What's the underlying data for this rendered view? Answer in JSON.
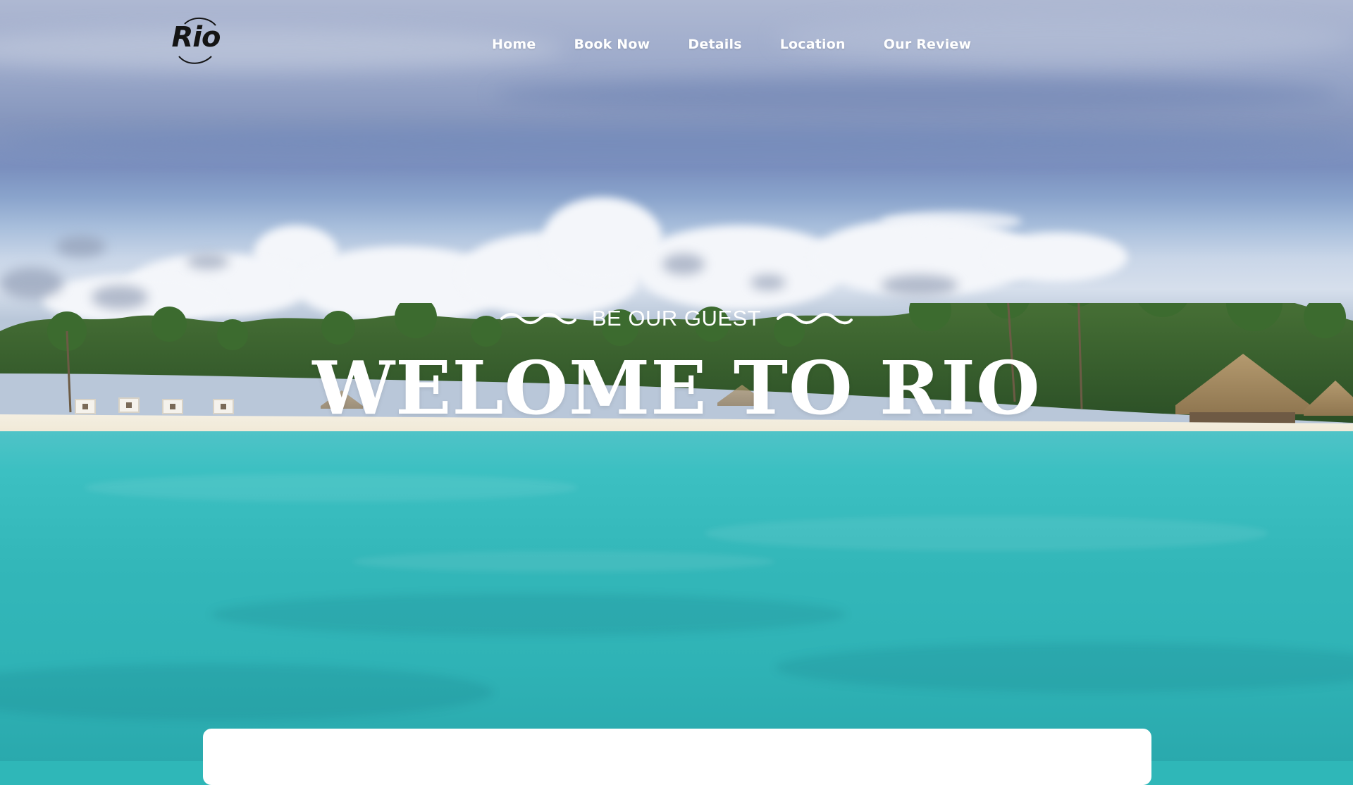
{
  "brand": {
    "logo_text": "Rio"
  },
  "nav": {
    "items": [
      {
        "label": "Home"
      },
      {
        "label": "Book Now"
      },
      {
        "label": "Details"
      },
      {
        "label": "Location"
      },
      {
        "label": "Our Review"
      }
    ]
  },
  "hero": {
    "eyebrow": "BE OUR GUEST",
    "headline": "WELOME TO RIO",
    "background_description_colors": {
      "sky": "#8596bd",
      "cloud": "#f4f6fa",
      "trees": "#2f5a2a",
      "sand": "#f2ebdb",
      "sea": "#33b7b9"
    }
  },
  "colors": {
    "nav_text": "#ffffff",
    "logo_text": "#141414",
    "headline_text": "#ffffff",
    "card_background": "#ffffff"
  }
}
